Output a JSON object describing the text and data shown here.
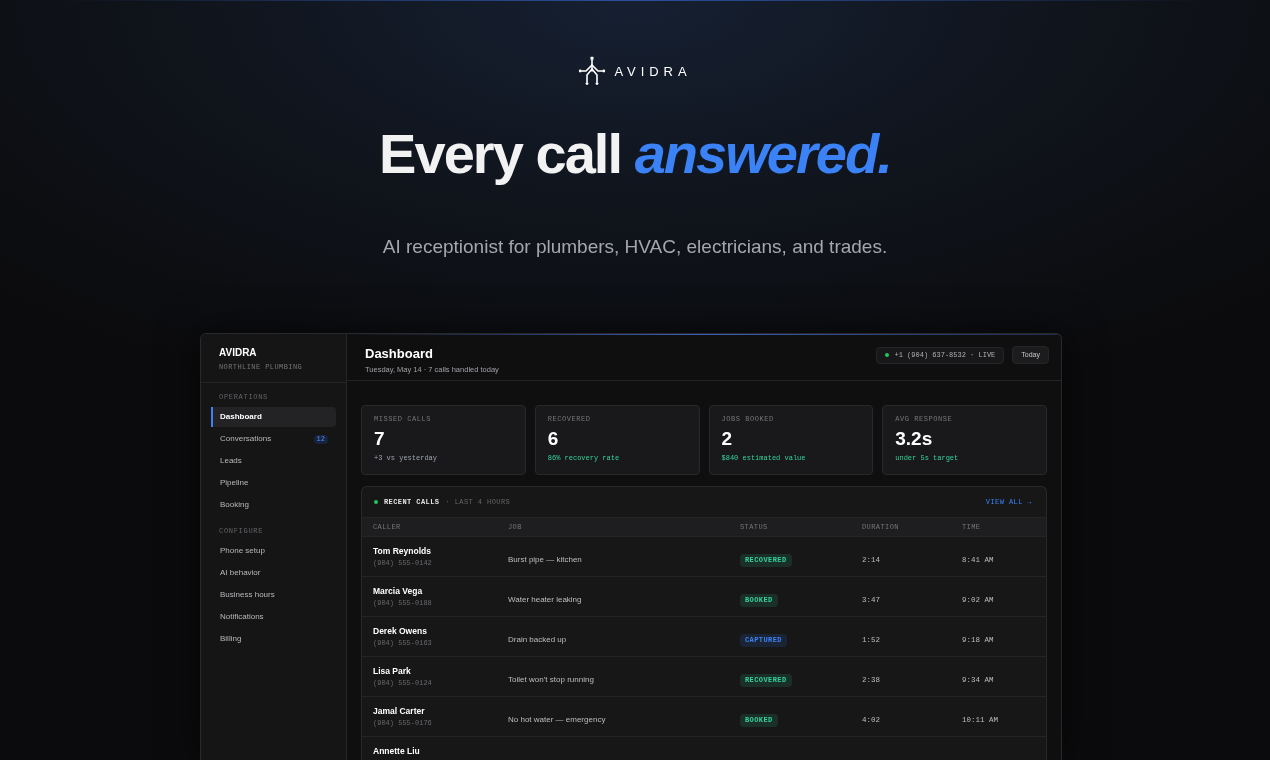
{
  "logo": {
    "wordmark": "AVIDRA"
  },
  "headline": {
    "text": "Every call",
    "accent": "answered."
  },
  "subtitle": "AI receptionist for plumbers, HVAC, electricians, and trades.",
  "dashboard": {
    "sidebar": {
      "brand": "AVIDRA",
      "org": "NORTHLINE PLUMBING",
      "sections": [
        {
          "title": "OPERATIONS",
          "items": [
            {
              "label": "Dashboard",
              "selected": true
            },
            {
              "label": "Conversations",
              "selected": false,
              "badge": "12"
            },
            {
              "label": "Leads",
              "selected": false
            },
            {
              "label": "Pipeline",
              "selected": false
            },
            {
              "label": "Booking",
              "selected": false
            }
          ]
        },
        {
          "title": "CONFIGURE",
          "items": [
            {
              "label": "Phone setup",
              "selected": false
            },
            {
              "label": "AI behavior",
              "selected": false
            },
            {
              "label": "Business hours",
              "selected": false
            },
            {
              "label": "Notifications",
              "selected": false
            },
            {
              "label": "Billing",
              "selected": false
            }
          ]
        }
      ]
    },
    "header": {
      "title": "Dashboard",
      "subtitle": "Tuesday, May 14 · 7 calls handled today",
      "phone_status": {
        "text": "+1 (904) 637-8532 · LIVE",
        "live": true
      },
      "range_button": "Today"
    },
    "stats": [
      {
        "label": "MISSED CALLS",
        "value": "7",
        "note": "+3 vs yesterday",
        "kind": "neutral"
      },
      {
        "label": "RECOVERED",
        "value": "6",
        "note": "86% recovery rate",
        "kind": "positive"
      },
      {
        "label": "JOBS BOOKED",
        "value": "2",
        "note": "$840 estimated value",
        "kind": "positive"
      },
      {
        "label": "AVG RESPONSE",
        "value": "3.2s",
        "note": "under 5s target",
        "kind": "positive"
      }
    ],
    "recent_calls": {
      "title": "RECENT CALLS",
      "subtitle": "· LAST 4 HOURS",
      "live": true,
      "link": "VIEW ALL →",
      "columns": [
        "CALLER",
        "JOB",
        "STATUS",
        "DURATION",
        "TIME"
      ],
      "rows": [
        {
          "caller": "Tom Reynolds",
          "phone": "(904) 555-0142",
          "job": "Burst pipe — kitchen",
          "status": "RECOVERED",
          "color": "#34d399",
          "duration": "2:14",
          "time": "8:41 AM"
        },
        {
          "caller": "Marcia Vega",
          "phone": "(904) 555-0188",
          "job": "Water heater leaking",
          "status": "BOOKED",
          "color": "#34d399",
          "duration": "3:47",
          "time": "9:02 AM"
        },
        {
          "caller": "Derek Owens",
          "phone": "(904) 555-0163",
          "job": "Drain backed up",
          "status": "CAPTURED",
          "color": "#3b82f6",
          "duration": "1:52",
          "time": "9:18 AM"
        },
        {
          "caller": "Lisa Park",
          "phone": "(904) 555-0124",
          "job": "Toilet won’t stop running",
          "status": "RECOVERED",
          "color": "#34d399",
          "duration": "2:38",
          "time": "9:34 AM"
        },
        {
          "caller": "Jamal Carter",
          "phone": "(904) 555-0176",
          "job": "No hot water — emergency",
          "status": "BOOKED",
          "color": "#34d399",
          "duration": "4:02",
          "time": "10:11 AM"
        },
        {
          "caller": "Annette Liu"
        }
      ]
    }
  }
}
